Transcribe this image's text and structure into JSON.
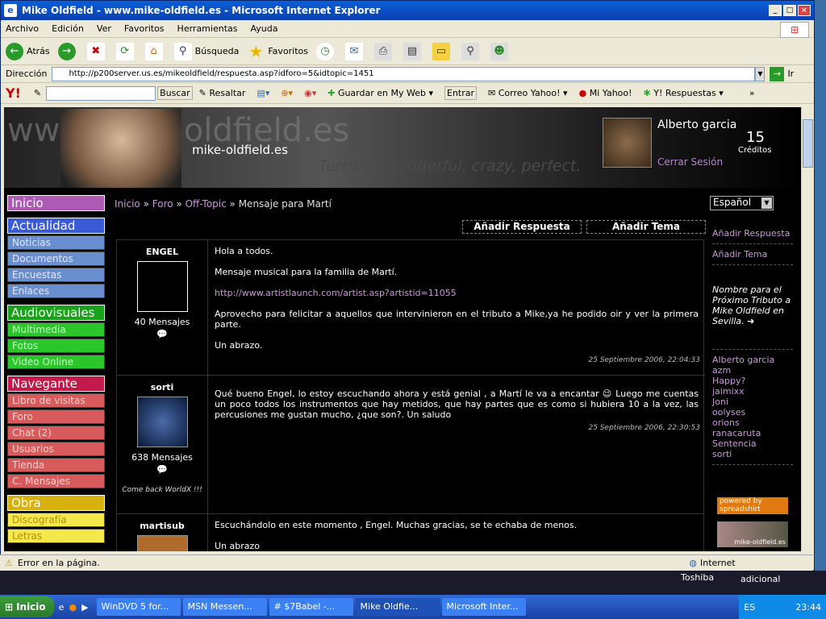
{
  "window": {
    "title": "Mike Oldfield - www.mike-oldfield.es - Microsoft Internet Explorer"
  },
  "menu": [
    "Archivo",
    "Edición",
    "Ver",
    "Favoritos",
    "Herramientas",
    "Ayuda"
  ],
  "toolbar": {
    "back": "Atrás",
    "search": "Búsqueda",
    "favorites": "Favoritos"
  },
  "address": {
    "label": "Dirección",
    "url": "http://p200server.us.es/mikeoldfield/respuesta.asp?idforo=5&idtopic=1451",
    "go": "Ir"
  },
  "yahoo": {
    "logo": "Y!",
    "search_btn": "Buscar",
    "highlight": "Resaltar",
    "save": "Guardar en My Web",
    "enter": "Entrar",
    "mail": "Correo Yahoo!",
    "my": "Mi Yahoo!",
    "answers": "Y! Respuestas"
  },
  "banner": {
    "bg_text": "www.mike-oldfield.es",
    "site": "mike-oldfield.es",
    "slogan": "Terrible, wonderful, crazy, perfect.",
    "user": "Alberto garcia",
    "credits": "15",
    "credits_label": "Créditos",
    "logout": "Cerrar Sesión"
  },
  "nav": {
    "inicio": "Inicio",
    "actualidad": {
      "title": "Actualidad",
      "items": [
        "Noticias",
        "Documentos",
        "Encuestas",
        "Enlaces"
      ]
    },
    "audiovisuales": {
      "title": "Audiovisuales",
      "items": [
        "Multimedia",
        "Fotos",
        "Video Online"
      ]
    },
    "navegante": {
      "title": "Navegante",
      "items": [
        "Libro de visitas",
        "Foro",
        "Chat (2)",
        "Usuarios",
        "Tienda",
        "C. Mensajes"
      ]
    },
    "obra": {
      "title": "Obra",
      "items": [
        "Discografía",
        "Letras"
      ]
    }
  },
  "breadcrumb": {
    "home": "Inicio",
    "forum": "Foro",
    "offtopic": "Off-Topic",
    "current": "» Mensaje para Martí",
    "sep": "»"
  },
  "language": "Español",
  "actions": {
    "reply": "Añadir Respuesta",
    "topic": "Añadir Tema"
  },
  "posts": [
    {
      "author": "ENGEL",
      "count": "40 Mensajes",
      "p1": "Hola a todos.",
      "p2": "Mensaje musical para la familia de Martí.",
      "link": "http://www.artistlaunch.com/artist.asp?artistid=11055",
      "p3": "Aprovecho para felicitar a aquellos que intervinieron en el tributo a Mike,ya he podido oir y ver la primera parte.",
      "p4": "Un abrazo.",
      "time": "25 Septiembre 2006, 22:04:33"
    },
    {
      "author": "sorti",
      "count": "638 Mensajes",
      "signature": "Come back WorldX !!!",
      "text": "Qué bueno Engel, lo estoy escuchando ahora y está genial , a Martí le va a encantar 😉 Luego me cuentas un poco todos los instrumentos que hay metidos, que hay partes que es como si hubiera 10 a la vez, las percusiones me gustan mucho, ¿que son?. Un saludo",
      "time": "25 Septiembre 2006, 22:30:53"
    },
    {
      "author": "martisub",
      "p1": "Escuchándolo en este momento , Engel. Muchas gracias, se te echaba de menos.",
      "p2": "Un abrazo"
    }
  ],
  "right": {
    "reply": "Añadir Respuesta",
    "topic": "Añadir Tema",
    "note": "Nombre para el Próximo Tributo a Mike Oldfield en Sevilla.",
    "users": [
      "Alberto garcia",
      "azm",
      "Happy?",
      "jaimixx",
      "Joni",
      "oolyses",
      "orions",
      "ranacaruta",
      "Sentencia",
      "sorti"
    ],
    "spread": "powered by spreadshirt",
    "mol": "mike-oldfield.es"
  },
  "status": {
    "text": "Error en la página.",
    "zone": "Internet"
  },
  "desktop": {
    "toshiba": "Toshiba",
    "adicional": "adicional"
  },
  "taskbar": {
    "start": "Inicio",
    "tasks": [
      "WinDVD 5 for...",
      "MSN Messen...",
      "# $7Babel -...",
      "Mike Oldfie...",
      "Microsoft Inter..."
    ],
    "clock": "23:44",
    "lang": "ES"
  }
}
